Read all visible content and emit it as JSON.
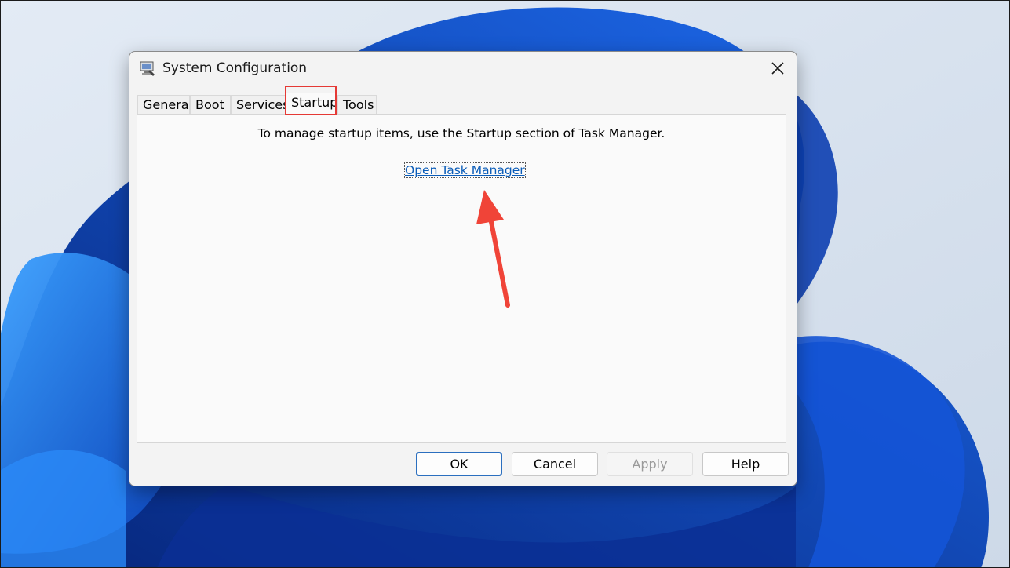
{
  "window": {
    "title": "System Configuration",
    "icons": {
      "app": "system-configuration-icon",
      "close": "close-icon"
    }
  },
  "tabs": [
    {
      "label": "General",
      "active": false
    },
    {
      "label": "Boot",
      "active": false
    },
    {
      "label": "Services",
      "active": false
    },
    {
      "label": "Startup",
      "active": true
    },
    {
      "label": "Tools",
      "active": false
    }
  ],
  "startup_panel": {
    "message": "To manage startup items, use the Startup section of Task Manager.",
    "link_text": "Open Task Manager"
  },
  "buttons": {
    "ok": "OK",
    "cancel": "Cancel",
    "apply": "Apply",
    "help": "Help"
  },
  "colors": {
    "accent": "#2b6fbf",
    "link": "#0a5cb8",
    "annotation": "#e53935"
  }
}
